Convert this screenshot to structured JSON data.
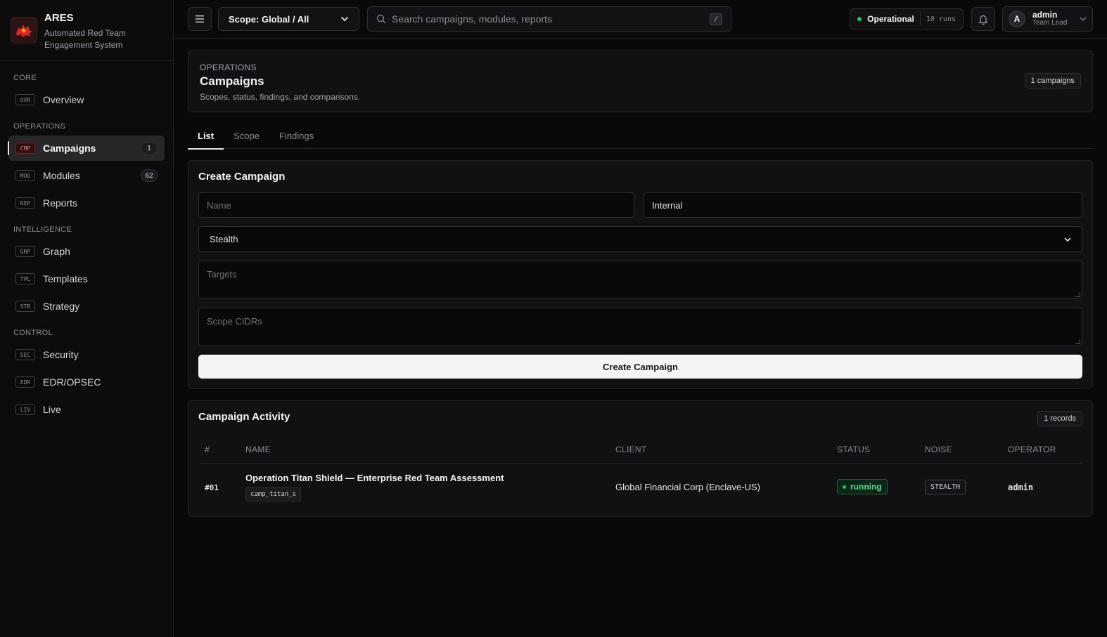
{
  "brand": {
    "name": "ARES",
    "subtitle": "Automated Red Team Engagement System"
  },
  "sidebar": {
    "sections": [
      {
        "title": "CORE",
        "items": [
          {
            "code": "OVR",
            "label": "Overview",
            "badge": ""
          }
        ]
      },
      {
        "title": "OPERATIONS",
        "items": [
          {
            "code": "CMP",
            "label": "Campaigns",
            "badge": "1"
          },
          {
            "code": "MOD",
            "label": "Modules",
            "badge": "62"
          },
          {
            "code": "REP",
            "label": "Reports",
            "badge": ""
          }
        ]
      },
      {
        "title": "INTELLIGENCE",
        "items": [
          {
            "code": "GRP",
            "label": "Graph",
            "badge": ""
          },
          {
            "code": "TPL",
            "label": "Templates",
            "badge": ""
          },
          {
            "code": "STR",
            "label": "Strategy",
            "badge": ""
          }
        ]
      },
      {
        "title": "CONTROL",
        "items": [
          {
            "code": "SEC",
            "label": "Security",
            "badge": ""
          },
          {
            "code": "EDR",
            "label": "EDR/OPSEC",
            "badge": ""
          },
          {
            "code": "LIV",
            "label": "Live",
            "badge": ""
          }
        ]
      }
    ]
  },
  "topbar": {
    "scope_label": "Scope: Global / All",
    "search_placeholder": "Search campaigns, modules, reports",
    "search_shortcut": "/",
    "status_label": "Operational",
    "runs_label": "10 runs",
    "user_initial": "A",
    "user_name": "admin",
    "user_role": "Team Lead"
  },
  "header": {
    "eyebrow": "OPERATIONS",
    "title": "Campaigns",
    "description": "Scopes, status, findings, and comparisons.",
    "count": "1 campaigns"
  },
  "tabs": [
    {
      "label": "List",
      "active": true
    },
    {
      "label": "Scope",
      "active": false
    },
    {
      "label": "Findings",
      "active": false
    }
  ],
  "form": {
    "title": "Create Campaign",
    "name_placeholder": "Name",
    "client_value": "Internal",
    "noise_value": "Stealth",
    "targets_placeholder": "Targets",
    "cidrs_placeholder": "Scope CIDRs",
    "submit_label": "Create Campaign"
  },
  "activity": {
    "title": "Campaign Activity",
    "count": "1 records",
    "columns": [
      "#",
      "NAME",
      "CLIENT",
      "STATUS",
      "NOISE",
      "OPERATOR"
    ],
    "rows": [
      {
        "id": "#01",
        "name": "Operation Titan Shield — Enterprise Red Team Assessment",
        "slug": "camp_titan_s",
        "client": "Global Financial Corp (Enclave-US)",
        "status": "running",
        "noise": "STEALTH",
        "operator": "admin"
      }
    ]
  },
  "colors": {
    "accent_status": "#22c55e",
    "active_code": "#f87171",
    "background": "#09090a"
  }
}
